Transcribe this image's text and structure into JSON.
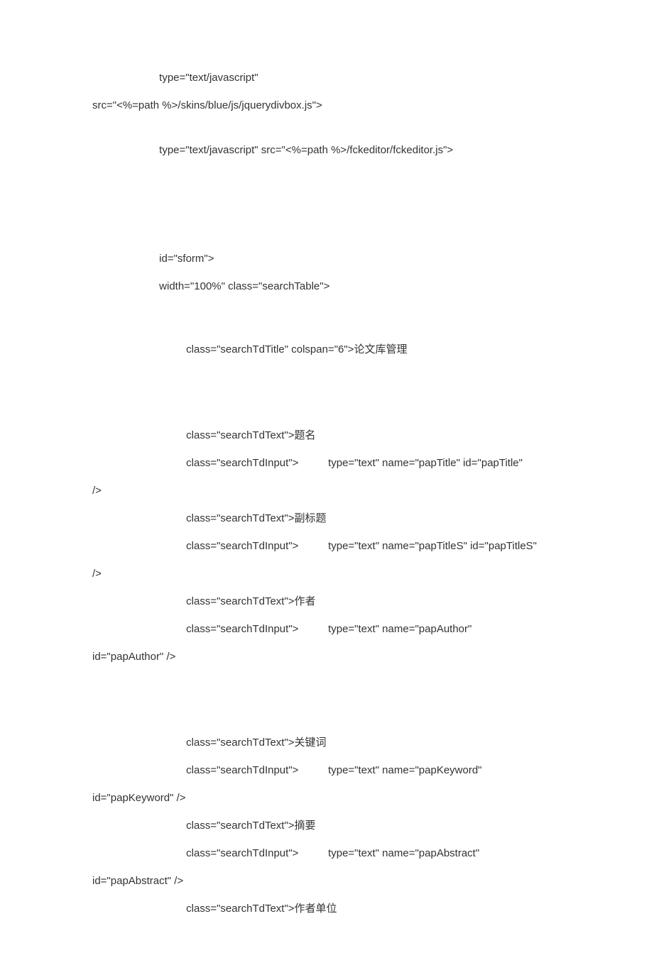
{
  "lines": [
    {
      "cls": "indent-1",
      "text": " type=\"text/javascript\""
    },
    {
      "cls": "indent-0",
      "text": "src=\"<%=path %>/skins/blue/js/jquerydivbox.js\">"
    },
    {
      "cls": "gap",
      "text": ""
    },
    {
      "cls": "indent-1",
      "text": " type=\"text/javascript\" src=\"<%=path %>/fckeditor/fckeditor.js\">"
    },
    {
      "cls": "gap-big",
      "text": ""
    },
    {
      "cls": "blank",
      "text": ""
    },
    {
      "cls": "blank",
      "text": ""
    },
    {
      "cls": "indent-1",
      "text": " id=\"sform\">"
    },
    {
      "cls": "indent-1",
      "text": " width=\"100%\" class=\"searchTable\">"
    },
    {
      "cls": "gap-big",
      "text": ""
    },
    {
      "cls": "indent-2",
      "text": " class=\"searchTdTitle\" colspan=\"6\">论文库管理"
    },
    {
      "cls": "gap-big",
      "text": ""
    },
    {
      "cls": "blank",
      "text": ""
    },
    {
      "cls": "indent-2",
      "text": " class=\"searchTdText\">题名"
    },
    {
      "cls": "indent-2",
      "text": " class=\"searchTdInput\">          type=\"text\" name=\"papTitle\" id=\"papTitle\""
    },
    {
      "cls": "indent-0",
      "text": "/>"
    },
    {
      "cls": "indent-2",
      "text": " class=\"searchTdText\">副标题"
    },
    {
      "cls": "indent-2",
      "text": " class=\"searchTdInput\">          type=\"text\" name=\"papTitleS\" id=\"papTitleS\""
    },
    {
      "cls": "indent-0",
      "text": "/>"
    },
    {
      "cls": "indent-2",
      "text": " class=\"searchTdText\">作者"
    },
    {
      "cls": "indent-2",
      "text": " class=\"searchTdInput\">          type=\"text\" name=\"papAuthor\""
    },
    {
      "cls": "indent-0",
      "text": "id=\"papAuthor\" />"
    },
    {
      "cls": "gap-big",
      "text": ""
    },
    {
      "cls": "blank",
      "text": ""
    },
    {
      "cls": "indent-2",
      "text": " class=\"searchTdText\">关键词"
    },
    {
      "cls": "indent-2",
      "text": " class=\"searchTdInput\">          type=\"text\" name=\"papKeyword\""
    },
    {
      "cls": "indent-0",
      "text": "id=\"papKeyword\" />"
    },
    {
      "cls": "indent-2",
      "text": " class=\"searchTdText\">摘要"
    },
    {
      "cls": "indent-2",
      "text": " class=\"searchTdInput\">          type=\"text\" name=\"papAbstract\""
    },
    {
      "cls": "indent-0",
      "text": "id=\"papAbstract\" />"
    },
    {
      "cls": "indent-2",
      "text": " class=\"searchTdText\">作者单位"
    }
  ]
}
